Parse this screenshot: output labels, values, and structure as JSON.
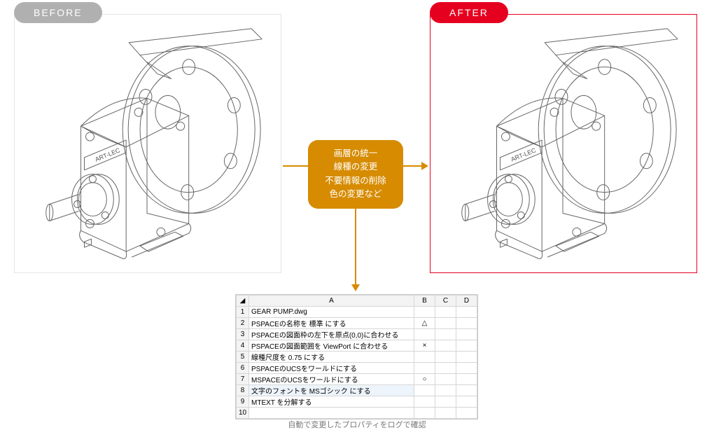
{
  "badges": {
    "before": "BEFORE",
    "after": "AFTER"
  },
  "center_label": {
    "l1": "画層の統一",
    "l2": "線種の変更",
    "l3": "不要情報の削除",
    "l4": "色の変更など"
  },
  "sheet": {
    "cols": [
      "A",
      "B",
      "C",
      "D"
    ],
    "rows": [
      {
        "n": "1",
        "a": "GEAR PUMP.dwg",
        "b": ""
      },
      {
        "n": "2",
        "a": "PSPACEの名称を 標準 にする",
        "b": "△"
      },
      {
        "n": "3",
        "a": "PSPACEの図面枠の左下を原点(0,0)に合わせる",
        "b": ""
      },
      {
        "n": "4",
        "a": "PSPACEの図面範囲を ViewPort に合わせる",
        "b": "×"
      },
      {
        "n": "5",
        "a": "線種尺度を 0.75 にする",
        "b": ""
      },
      {
        "n": "6",
        "a": "PSPACEのUCSをワールドにする",
        "b": ""
      },
      {
        "n": "7",
        "a": "MSPACEのUCSをワールドにする",
        "b": "○"
      },
      {
        "n": "8",
        "a": "文字のフォントを MSゴシック にする",
        "b": ""
      },
      {
        "n": "9",
        "a": "MTEXT を分解する",
        "b": ""
      },
      {
        "n": "10",
        "a": "",
        "b": ""
      }
    ]
  },
  "caption": "自動で変更したプロパティをログで確認",
  "drawing_label": "ART-LEC"
}
